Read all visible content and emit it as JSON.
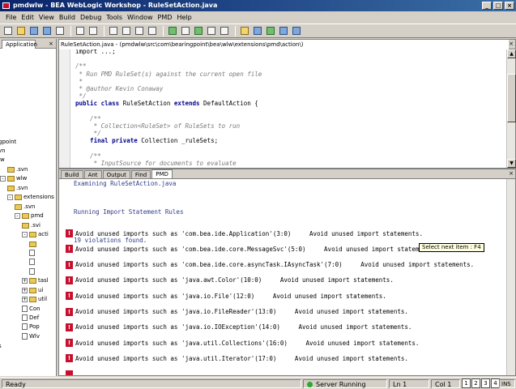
{
  "window": {
    "title": "pmdwlw - BEA WebLogic Workshop - RuleSetAction.java",
    "controls": [
      "_",
      "□",
      "×"
    ]
  },
  "menu": [
    "File",
    "Edit",
    "View",
    "Build",
    "Debug",
    "Tools",
    "Window",
    "PMD",
    "Help"
  ],
  "toolbar_icons": [
    "new-file-icon",
    "open-folder-icon",
    "save-icon",
    "save-all-icon",
    "print-icon",
    "undo-icon",
    "redo-icon",
    "cut-icon",
    "copy-icon",
    "paste-icon",
    "find-icon",
    "run-icon",
    "stop-icon",
    "debug-icon",
    "step-icon",
    "step-into-icon",
    "build-icon",
    "deploy-icon",
    "server-icon",
    "browser-icon",
    "help-icon"
  ],
  "left_panel": {
    "tab": "Application",
    "close": "×",
    "tree": [
      {
        "label": "gpoint",
        "depth": 0,
        "kind": "text",
        "toggle": ""
      },
      {
        "label": "vn",
        "depth": 0,
        "kind": "text",
        "toggle": ""
      },
      {
        "label": "lw",
        "depth": 0,
        "kind": "text",
        "toggle": ""
      },
      {
        "label": ".svn",
        "depth": 1,
        "kind": "folder",
        "toggle": ""
      },
      {
        "label": "wlw",
        "depth": 0,
        "kind": "folder",
        "toggle": "-"
      },
      {
        "label": ".svn",
        "depth": 1,
        "kind": "folder",
        "toggle": ""
      },
      {
        "label": "extensions",
        "depth": 1,
        "kind": "folder",
        "toggle": "-"
      },
      {
        "label": ".svn",
        "depth": 2,
        "kind": "folder",
        "toggle": ""
      },
      {
        "label": "pmd",
        "depth": 2,
        "kind": "folder",
        "toggle": "-"
      },
      {
        "label": ".svi",
        "depth": 3,
        "kind": "folder",
        "toggle": ""
      },
      {
        "label": "acti",
        "depth": 3,
        "kind": "folder",
        "toggle": "-"
      },
      {
        "label": "",
        "depth": 4,
        "kind": "folder",
        "toggle": ""
      },
      {
        "label": "",
        "depth": 4,
        "kind": "file",
        "toggle": ""
      },
      {
        "label": "",
        "depth": 4,
        "kind": "file",
        "toggle": ""
      },
      {
        "label": "",
        "depth": 4,
        "kind": "file",
        "toggle": ""
      },
      {
        "label": "tasl",
        "depth": 3,
        "kind": "folder",
        "toggle": "+"
      },
      {
        "label": "ui",
        "depth": 3,
        "kind": "folder",
        "toggle": "+"
      },
      {
        "label": "util",
        "depth": 3,
        "kind": "folder",
        "toggle": "+"
      },
      {
        "label": "Con",
        "depth": 3,
        "kind": "file",
        "toggle": ""
      },
      {
        "label": "Def",
        "depth": 3,
        "kind": "file",
        "toggle": ""
      },
      {
        "label": "Pop",
        "depth": 3,
        "kind": "file",
        "toggle": ""
      },
      {
        "label": "Wlv",
        "depth": 3,
        "kind": "file",
        "toggle": ""
      },
      {
        "label": "s",
        "depth": 0,
        "kind": "text",
        "toggle": ""
      }
    ]
  },
  "editor": {
    "tab": "RuleSetAction.java - (pmdwlw\\src\\com\\bearingpoint\\bea\\wlw\\extensions\\pmd\\action\\)",
    "close": "×",
    "lines": [
      [
        {
          "t": "import ...;",
          "c": "plain"
        }
      ],
      [
        {
          "t": "",
          "c": "plain"
        }
      ],
      [
        {
          "t": "/**",
          "c": "comment"
        }
      ],
      [
        {
          "t": " * Run PMD RuleSet(s) against the current open file",
          "c": "comment"
        }
      ],
      [
        {
          "t": " *",
          "c": "comment"
        }
      ],
      [
        {
          "t": " * @author Kevin Conaway",
          "c": "comment"
        }
      ],
      [
        {
          "t": " */",
          "c": "comment"
        }
      ],
      [
        {
          "t": "public class ",
          "c": "kw"
        },
        {
          "t": "RuleSetAction ",
          "c": "plain"
        },
        {
          "t": "extends ",
          "c": "kw"
        },
        {
          "t": "DefaultAction {",
          "c": "plain"
        }
      ],
      [
        {
          "t": "",
          "c": "plain"
        }
      ],
      [
        {
          "t": "    /**",
          "c": "comment"
        }
      ],
      [
        {
          "t": "     * Collection<RuleSet> of RuleSets to run",
          "c": "comment"
        }
      ],
      [
        {
          "t": "     */",
          "c": "comment"
        }
      ],
      [
        {
          "t": "    final private ",
          "c": "kw"
        },
        {
          "t": "Collection _ruleSets;",
          "c": "plain"
        }
      ],
      [
        {
          "t": "",
          "c": "plain"
        }
      ],
      [
        {
          "t": "    /**",
          "c": "comment"
        }
      ],
      [
        {
          "t": "     * InputSource for documents to evaluate",
          "c": "comment"
        }
      ]
    ]
  },
  "output": {
    "tabs": [
      "Build",
      "Ant",
      "Output",
      "Find",
      "PMD"
    ],
    "active_tab": "PMD",
    "close": "×",
    "header_lines": [
      "Examining RuleSetAction.java",
      "",
      "Running Import Statement Rules",
      "",
      "19 violations found."
    ],
    "violations": [
      "Avoid unused imports such as 'com.bea.ide.Application'(3:0)     Avoid unused import statements.",
      "Avoid unused imports such as 'com.bea.ide.core.MessageSvc'(5:0)     Avoid unused import statements.",
      "Avoid unused imports such as 'com.bea.ide.core.asyncTask.IAsyncTask'(7:0)     Avoid unused import statements.",
      "Avoid unused imports such as 'java.awt.Color'(10:0)     Avoid unused import statements.",
      "Avoid unused imports such as 'java.io.File'(12:0)     Avoid unused import statements.",
      "Avoid unused imports such as 'java.io.FileReader'(13:0)     Avoid unused import statements.",
      "Avoid unused imports such as 'java.io.IOException'(14:0)     Avoid unused import statements.",
      "Avoid unused imports such as 'java.util.Collections'(16:0)     Avoid unused import statements.",
      "Avoid unused imports such as 'java.util.Iterator'(17:0)     Avoid unused import statements."
    ],
    "error_glyph": "!",
    "tooltip": "Select next item : F4"
  },
  "status": {
    "ready": "Ready",
    "server": "Server Running",
    "line": "Ln 1",
    "col": "Col 1",
    "ins": "INS",
    "pages": [
      "1",
      "2",
      "3",
      "4"
    ]
  },
  "colors": {
    "title_start": "#0a246a",
    "title_end": "#3a6ea5",
    "comment": "#7a7a7a",
    "keyword": "#00008b",
    "error": "#c8102e",
    "server_ok": "#2ea82e"
  }
}
